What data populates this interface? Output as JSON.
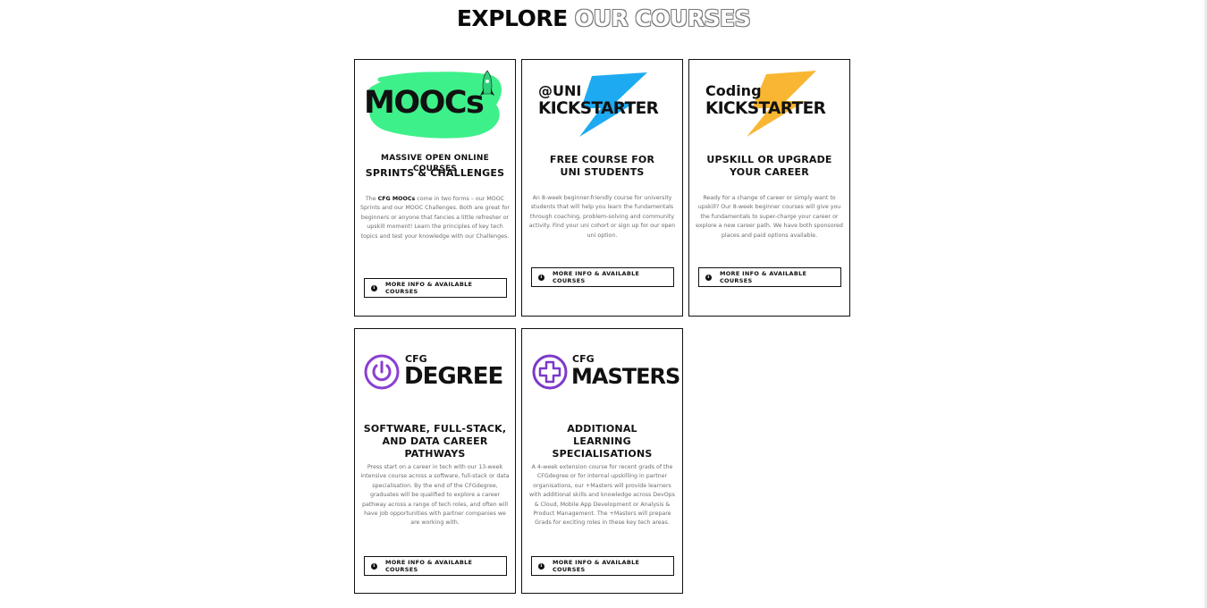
{
  "heading": {
    "part1": "EXPLORE",
    "part2": "OUR COURSES"
  },
  "colors": {
    "mooc_brush": "#3ef08a",
    "kickstarter_bolt_uni": "#1eaaf1",
    "kickstarter_bolt_coding": "#f9b632",
    "degree_purple": "#8a3fd1",
    "masters_purple": "#7b3ac9"
  },
  "cards": [
    {
      "logo": {
        "text": "MOOCs",
        "icon": "rocket-icon"
      },
      "title_line1": "MASSIVE OPEN ONLINE COURSES",
      "title_line2": "SPRINTS & CHALLENGES",
      "desc_lead": "The ",
      "desc_bold": "CFG MOOCs",
      "desc_rest": " come in two forms – our MOOC Sprints and our MOOC Challenges. Both are great for beginners or anyone that fancies a little refresher or upskill moment! Learn the principles of key tech topics and test your knowledge with our Challenges.",
      "button": "MORE INFO & AVAILABLE COURSES"
    },
    {
      "logo": {
        "line1": "@UNI",
        "line2": "KICKSTARTER",
        "icon": "lightning-bolt-icon"
      },
      "title": "FREE COURSE FOR UNI STUDENTS",
      "desc": "An 8-week beginner-friendly course for university students that will help you learn the fundamentals through coaching, problem-solving and community activity. Find your uni cohort or sign up for our open uni option.",
      "button": "MORE INFO & AVAILABLE COURSES"
    },
    {
      "logo": {
        "line1": "Coding",
        "line2": "KICKSTARTER",
        "icon": "lightning-bolt-icon"
      },
      "title": "UPSKILL OR UPGRADE YOUR CAREER",
      "desc": "Ready for a change of career or simply want to upskill? Our 8-week beginner courses will give you the fundamentals to super-charge your career or explore a new career path. We have both sponsored places and paid options available.",
      "button": "MORE INFO & AVAILABLE COURSES"
    },
    {
      "logo": {
        "line1": "CFG",
        "line2": "DEGREE",
        "icon": "power-icon"
      },
      "title": "SOFTWARE, FULL-STACK, AND DATA CAREER PATHWAYS",
      "desc": "Press start on a career in tech with our 13-week intensive course across a software, full-stack or data specialisation. By the end of the CFGdegree, graduates will be qualified to explore a career pathway across a range of tech roles, and often will have job opportunities with partner companies we are working with.",
      "button": "MORE INFO & AVAILABLE COURSES"
    },
    {
      "logo": {
        "line1": "CFG",
        "line2": "MASTERS",
        "icon": "plus-icon"
      },
      "title": "ADDITIONAL LEARNING SPECIALISATIONS",
      "desc": "A 4-week extension course for recent grads of the CFGdegree or for internal upskilling in partner organisations, our +Masters will provide learners with additional skills and knowledge across DevOps & Cloud, Mobile App Development or Analysis & Product Management. The +Masters will prepare Grads for exciting roles in these key tech areas.",
      "button": "MORE INFO & AVAILABLE COURSES"
    }
  ]
}
